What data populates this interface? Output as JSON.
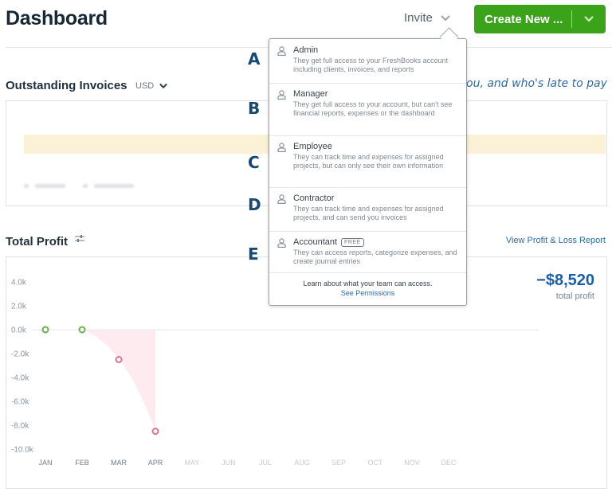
{
  "header": {
    "title": "Dashboard",
    "invite_label": "Invite",
    "create_label": "Create New ..."
  },
  "outstanding": {
    "title": "Outstanding Invoices",
    "currency": "USD",
    "annotation_text": "ou, and who's late to pay"
  },
  "invite_menu": {
    "roles": [
      {
        "name": "Admin",
        "desc": "They get full access to your FreshBooks account including clients, invoices, and reports",
        "badge": null
      },
      {
        "name": "Manager",
        "desc": "They get full access to your account, but can't see financial reports, expenses or the dashboard",
        "badge": null
      },
      {
        "name": "Employee",
        "desc": "They can track time and expenses for assigned projects, but can only see their own information",
        "badge": null
      },
      {
        "name": "Contractor",
        "desc": "They can track time and expenses for assigned projects, and can send you invoices",
        "badge": null
      },
      {
        "name": "Accountant",
        "desc": "They can access reports, categorize expenses, and create journal entries",
        "badge": "FREE"
      }
    ],
    "footer_text": "Learn about what your team can access.",
    "footer_link": "See Permissions"
  },
  "annotations": [
    "A",
    "B",
    "C",
    "D",
    "E"
  ],
  "profit": {
    "title": "Total Profit",
    "report_link": "View Profit & Loss Report",
    "value": "−$8,520",
    "value_label": "total profit"
  },
  "colors": {
    "brand_green": "#3aa31a",
    "link_blue": "#2a6cad",
    "positive_point": "#6ab04c",
    "negative_point": "#d9738f",
    "negative_fill": "#fde8ec"
  },
  "chart_data": {
    "type": "area",
    "title": "Total Profit",
    "xlabel": "",
    "ylabel": "",
    "categories": [
      "JAN",
      "FEB",
      "MAR",
      "APR",
      "MAY",
      "JUN",
      "JUL",
      "AUG",
      "SEP",
      "OCT",
      "NOV",
      "DEC"
    ],
    "active_categories": 4,
    "y_ticks": [
      "4.0k",
      "2.0k",
      "0.0k",
      "-2.0k",
      "-4.0k",
      "-6.0k",
      "-8.0k",
      "-10.0k"
    ],
    "y_tick_values": [
      4000,
      2000,
      0,
      -2000,
      -4000,
      -6000,
      -8000,
      -10000
    ],
    "ylim": [
      -10000,
      4000
    ],
    "series": [
      {
        "name": "Profit",
        "values": [
          0,
          0,
          -2500,
          -8500
        ]
      }
    ],
    "grid": false,
    "legend": "none"
  }
}
